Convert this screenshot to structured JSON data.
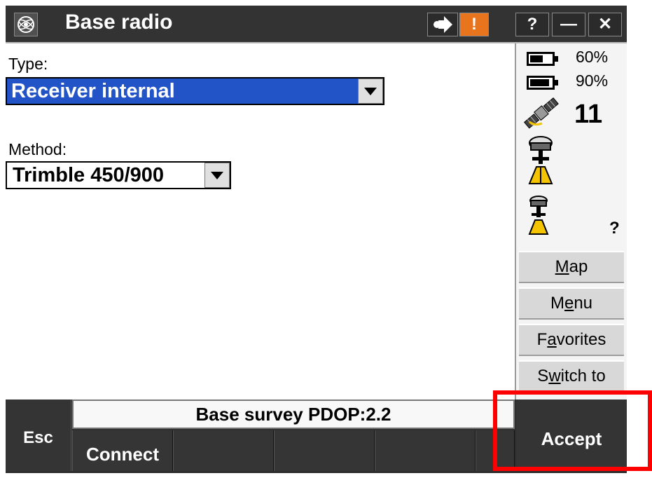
{
  "window": {
    "title": "Base radio",
    "buttons": {
      "help": "?",
      "minimize": "—",
      "close": "✕",
      "alert": "!"
    }
  },
  "form": {
    "type_label": "Type:",
    "type_value": "Receiver internal",
    "method_label": "Method:",
    "method_value": "Trimble 450/900"
  },
  "status_panel": {
    "battery1": "60%",
    "battery1_level": 0.6,
    "battery2": "90%",
    "battery2_level": 0.9,
    "satellites": "11",
    "rover_status": "?",
    "buttons": [
      {
        "label": "Map"
      },
      {
        "label": "Menu"
      },
      {
        "label": "Favorites"
      },
      {
        "label": "Switch to"
      }
    ]
  },
  "footer": {
    "esc_label": "Esc",
    "status_text": "Base survey  PDOP:2.2",
    "connect_label": "Connect",
    "accept_label": "Accept"
  },
  "colors": {
    "titlebar": "#333333",
    "selection": "#2354c7",
    "alert": "#e8741d",
    "highlight": "#ff0000",
    "receiver_yellow": "#f5c400"
  }
}
